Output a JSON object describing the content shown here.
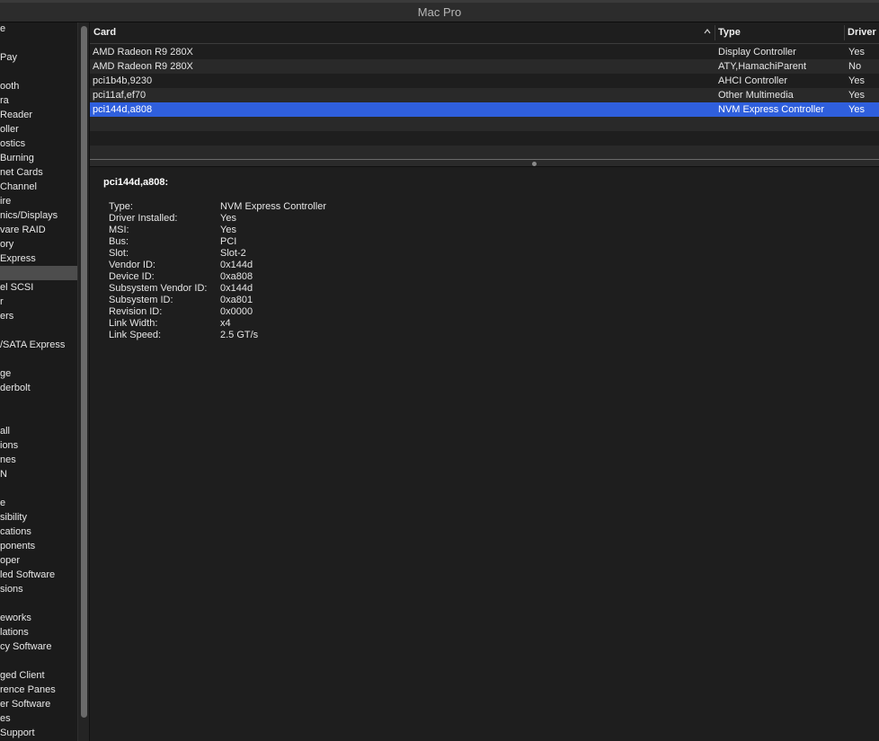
{
  "window": {
    "title": "Mac Pro"
  },
  "sidebar": {
    "items": [
      {
        "label": "e"
      },
      {
        "label": ""
      },
      {
        "label": " Pay"
      },
      {
        "label": ""
      },
      {
        "label": "ooth"
      },
      {
        "label": "ra"
      },
      {
        "label": "Reader"
      },
      {
        "label": "oller"
      },
      {
        "label": "ostics"
      },
      {
        "label": "Burning"
      },
      {
        "label": "net Cards"
      },
      {
        "label": "Channel"
      },
      {
        "label": "ire"
      },
      {
        "label": "nics/Displays"
      },
      {
        "label": "vare RAID"
      },
      {
        "label": "ory"
      },
      {
        "label": "Express"
      },
      {
        "label": "",
        "selected": true
      },
      {
        "label": "el SCSI"
      },
      {
        "label": "r"
      },
      {
        "label": "ers"
      },
      {
        "label": ""
      },
      {
        "label": "/SATA Express"
      },
      {
        "label": ""
      },
      {
        "label": "ge"
      },
      {
        "label": "derbolt"
      },
      {
        "label": ""
      },
      {
        "label": ""
      },
      {
        "label": "all"
      },
      {
        "label": "ions"
      },
      {
        "label": "nes"
      },
      {
        "label": "N"
      },
      {
        "label": ""
      },
      {
        "label": "e"
      },
      {
        "label": "sibility"
      },
      {
        "label": "cations"
      },
      {
        "label": "ponents"
      },
      {
        "label": "oper"
      },
      {
        "label": "led Software"
      },
      {
        "label": "sions"
      },
      {
        "label": ""
      },
      {
        "label": "eworks"
      },
      {
        "label": "lations"
      },
      {
        "label": "cy Software"
      },
      {
        "label": ""
      },
      {
        "label": "ged Client"
      },
      {
        "label": "rence Panes"
      },
      {
        "label": "er Software"
      },
      {
        "label": "es"
      },
      {
        "label": "Support"
      }
    ]
  },
  "table": {
    "columns": {
      "card": "Card",
      "type": "Type",
      "driver": "Driver"
    },
    "rows": [
      {
        "card": "AMD Radeon R9 280X",
        "type": "Display Controller",
        "driver": "Yes"
      },
      {
        "card": "AMD Radeon R9 280X",
        "type": "ATY,HamachiParent",
        "driver": "No"
      },
      {
        "card": "pci1b4b,9230",
        "type": "AHCI Controller",
        "driver": "Yes"
      },
      {
        "card": "pci11af,ef70",
        "type": "Other Multimedia",
        "driver": "Yes"
      },
      {
        "card": "pci144d,a808",
        "type": "NVM Express Controller",
        "driver": "Yes",
        "selected": true
      }
    ]
  },
  "details": {
    "title": "pci144d,a808:",
    "fields": [
      {
        "key": "Type:",
        "value": "NVM Express Controller"
      },
      {
        "key": "Driver Installed:",
        "value": "Yes"
      },
      {
        "key": "MSI:",
        "value": "Yes"
      },
      {
        "key": "Bus:",
        "value": "PCI"
      },
      {
        "key": "Slot:",
        "value": "Slot-2"
      },
      {
        "key": "Vendor ID:",
        "value": "0x144d"
      },
      {
        "key": "Device ID:",
        "value": "0xa808"
      },
      {
        "key": "Subsystem Vendor ID:",
        "value": "0x144d"
      },
      {
        "key": "Subsystem ID:",
        "value": "0xa801"
      },
      {
        "key": "Revision ID:",
        "value": "0x0000"
      },
      {
        "key": "Link Width:",
        "value": "x4"
      },
      {
        "key": "Link Speed:",
        "value": "2.5 GT/s"
      }
    ]
  },
  "icons": {
    "sort": "chevron-up-icon",
    "splitter": "splitter-handle-icon"
  }
}
